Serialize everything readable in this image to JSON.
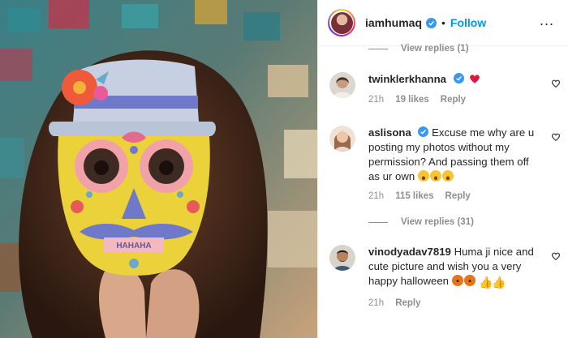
{
  "post": {
    "username": "iamhumaq",
    "separator": "•",
    "follow_label": "Follow",
    "more_icon": "..."
  },
  "comments": {
    "top_view_replies": "View replies (1)",
    "items": [
      {
        "username": "twinklerkhanna",
        "text": "",
        "time": "21h",
        "likes": "19 likes",
        "reply": "Reply"
      },
      {
        "username": "aslisona",
        "text": "Excuse me why are u posting my photos without my permission? And passing them off as ur own",
        "time": "21h",
        "likes": "115 likes",
        "reply": "Reply",
        "view_replies": "View replies (31)"
      },
      {
        "username": "vinodyadav7819",
        "text": "Huma ji nice and cute picture and wish you a very happy halloween",
        "time": "21h",
        "reply": "Reply"
      }
    ]
  },
  "photo": {
    "mask_text": "HAHAHA"
  },
  "colors": {
    "accent": "#0095f6",
    "muted": "#8e8e8e",
    "text": "#262626",
    "heart": "#ed4956"
  },
  "icons": [
    "verified-badge-icon",
    "more-options-icon",
    "heart-outline-icon",
    "red-heart-emoji",
    "laughing-emoji",
    "pumpkin-emoji",
    "thumbs-up-emoji"
  ]
}
